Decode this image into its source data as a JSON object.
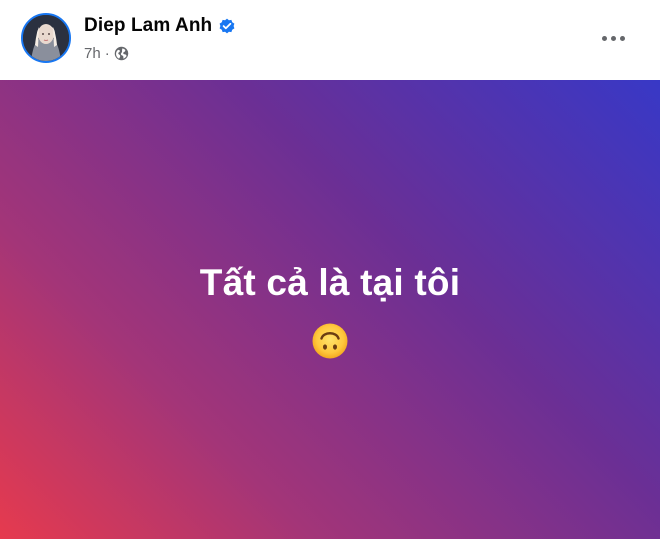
{
  "post": {
    "author": {
      "name": "Diep Lam Anh",
      "verified": true,
      "avatar_icon": "profile-photo"
    },
    "time": "7h",
    "separator": "·",
    "privacy_icon": "globe-icon",
    "menu_icon": "more-horizontal-icon",
    "content": {
      "text": "Tất cả là tại tôi",
      "emoji": "🙃",
      "background": {
        "type": "gradient",
        "colors": [
          "#e63a4e",
          "#a33578",
          "#6b2f95",
          "#3838c6"
        ]
      }
    }
  },
  "colors": {
    "verified_blue": "#1877f2",
    "meta_gray": "#65676b",
    "name_black": "#050505"
  }
}
